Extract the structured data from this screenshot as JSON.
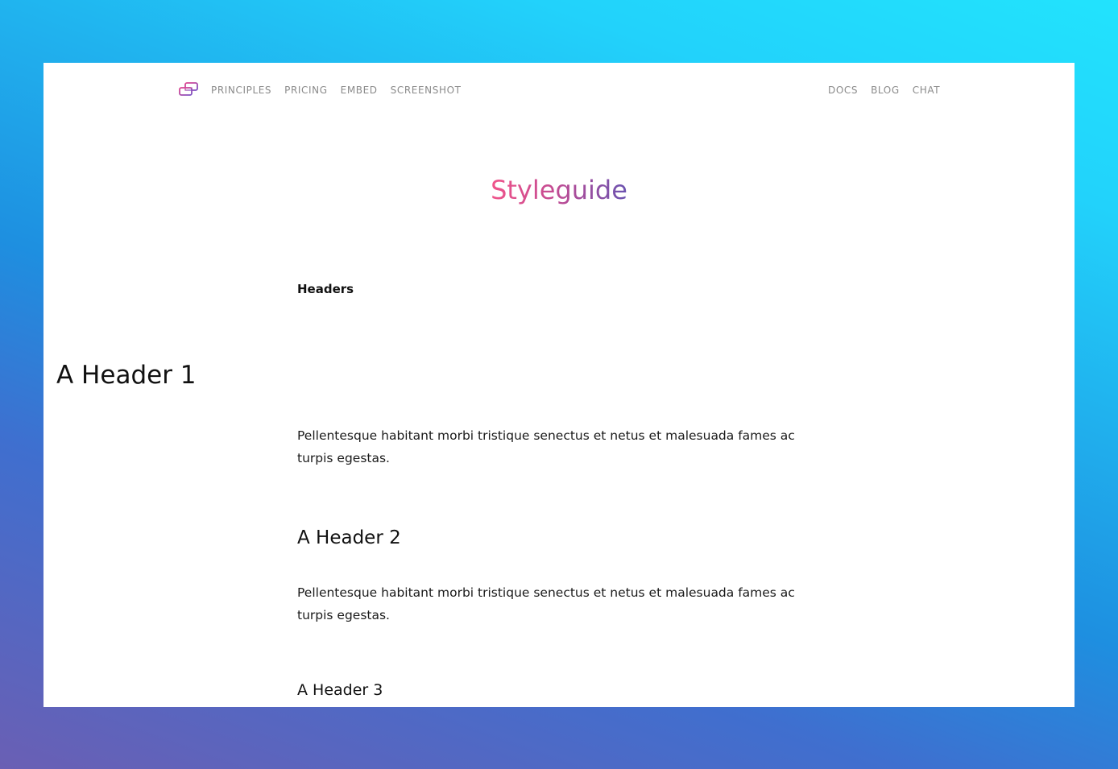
{
  "nav": {
    "logo_icon": "overlapping-rectangles-logo-icon",
    "left_links": [
      "PRINCIPLES",
      "PRICING",
      "EMBED",
      "SCREENSHOT"
    ],
    "right_links": [
      "DOCS",
      "BLOG",
      "CHAT"
    ]
  },
  "page": {
    "title": "Styleguide",
    "title_gradient": [
      "#f0548a",
      "#c54b92",
      "#6a52b0"
    ],
    "section_label": "Headers",
    "h1": "A Header 1",
    "paragraph_1": "Pellentesque habitant morbi tristique senectus et netus et malesuada fames ac turpis egestas.",
    "h2": "A Header 2",
    "paragraph_2": "Pellentesque habitant morbi tristique senectus et netus et malesuada fames ac turpis egestas.",
    "h3": "A Header 3"
  },
  "colors": {
    "background_gradient": [
      "#22e3fd",
      "#1e8fe0",
      "#6a5fb4"
    ],
    "nav_text": "#8a8a8a",
    "body_text": "#111111",
    "logo": [
      "#e0458f",
      "#7a52c4"
    ]
  }
}
